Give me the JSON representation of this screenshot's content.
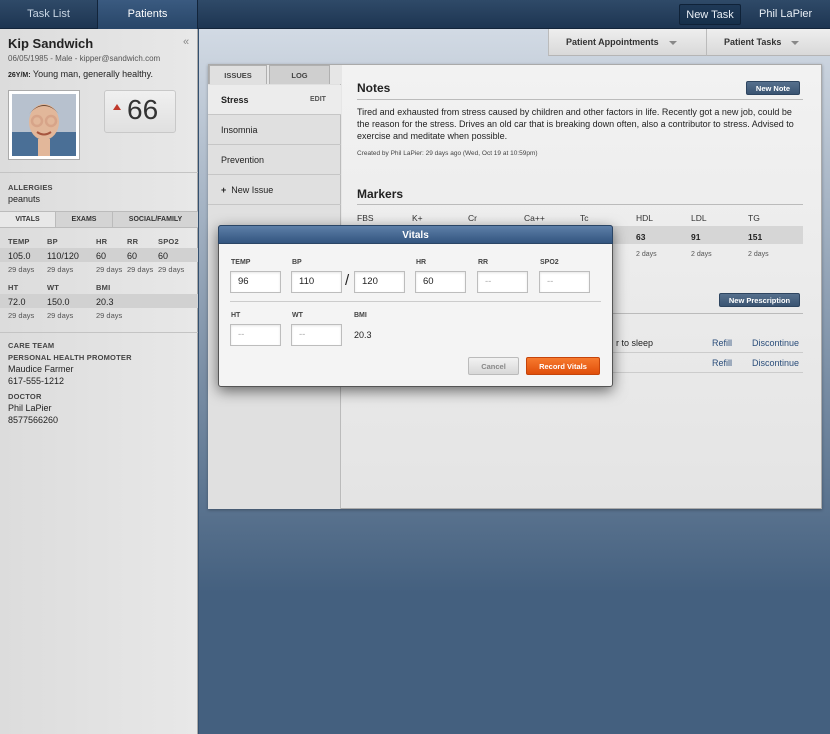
{
  "topbar": {
    "tabs": [
      "Task List",
      "Patients"
    ],
    "new_task": "New Task",
    "user": "Phil LaPier"
  },
  "patient": {
    "name": "Kip Sandwich",
    "meta": "06/05/1985 - Male - kipper@sandwich.com",
    "summary_prefix": "26Y/M:",
    "summary": "Young man, generally healthy.",
    "score": "66"
  },
  "allergies": {
    "label": "ALLERGIES",
    "value": "peanuts"
  },
  "vitals_tabs": [
    "VITALS",
    "EXAMS",
    "SOCIAL/FAMILY"
  ],
  "vitals": {
    "row1": [
      {
        "label": "TEMP",
        "value": "105.0",
        "age": "29 days"
      },
      {
        "label": "BP",
        "value": "110/120",
        "age": "29 days"
      },
      {
        "label": "HR",
        "value": "60",
        "age": "29 days"
      },
      {
        "label": "RR",
        "value": "60",
        "age": "29 days"
      },
      {
        "label": "SPO2",
        "value": "60",
        "age": "29 days"
      }
    ],
    "row2": [
      {
        "label": "HT",
        "value": "72.0",
        "age": "29 days"
      },
      {
        "label": "WT",
        "value": "150.0",
        "age": "29 days"
      },
      {
        "label": "BMI",
        "value": "20.3",
        "age": "29 days"
      }
    ]
  },
  "care_team": {
    "label": "CARE TEAM",
    "promoter_label": "PERSONAL HEALTH PROMOTER",
    "promoter_name": "Maudice Farmer",
    "promoter_phone": "617-555-1212",
    "doctor_label": "DOCTOR",
    "doctor_name": "Phil LaPier",
    "doctor_phone": "8577566260"
  },
  "header_buttons": {
    "appointments": "Patient Appointments",
    "tasks": "Patient Tasks"
  },
  "issue_tabs": [
    "ISSUES",
    "LOG"
  ],
  "issues": {
    "selected": "Stress",
    "edit": "EDIT",
    "items": [
      "Insomnia",
      "Prevention"
    ],
    "new_issue": "New Issue"
  },
  "notes": {
    "title": "Notes",
    "new_note": "New Note",
    "text": "Tired and exhausted from stress caused by children and other factors in life. Recently got a new job, could be the reason for the stress. Drives an old car that is breaking down often, also a contributor to stress. Advised to exercise and meditate when possible.",
    "created": "Created by Phil LaPier: 29 days ago (Wed, Oct 19 at 10:59pm)"
  },
  "markers": {
    "title": "Markers",
    "cols": [
      "FBS",
      "K+",
      "Cr",
      "Ca++",
      "Tc",
      "HDL",
      "LDL",
      "TG"
    ],
    "values": {
      "HDL": "63",
      "LDL": "91",
      "TG": "151"
    },
    "ages": {
      "HDL": "2 days",
      "LDL": "2 days",
      "TG": "2 days"
    }
  },
  "prescriptions": {
    "new": "New Prescription",
    "row1_text": "r to sleep",
    "refill": "Refill",
    "discontinue": "Discontinue"
  },
  "modal": {
    "title": "Vitals",
    "labels": {
      "temp": "TEMP",
      "bp": "BP",
      "hr": "HR",
      "rr": "RR",
      "spo2": "SPO2",
      "ht": "HT",
      "wt": "WT",
      "bmi": "BMI"
    },
    "values": {
      "temp": "96",
      "bp_sys": "110",
      "bp_sep": "/",
      "bp_dia": "120",
      "hr": "60",
      "rr": "--",
      "spo2": "--",
      "ht": "--",
      "wt": "--",
      "bmi": "20.3"
    },
    "cancel": "Cancel",
    "record": "Record Vitals"
  }
}
